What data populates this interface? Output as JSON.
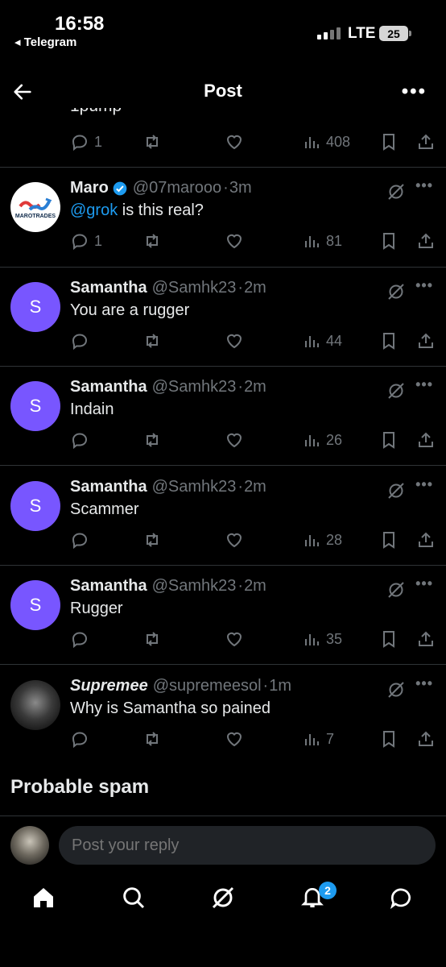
{
  "status_bar": {
    "time": "16:58",
    "back_app": "◂ Telegram",
    "network": "LTE",
    "battery": "25"
  },
  "header": {
    "title": "Post"
  },
  "top_post": {
    "text_fragment": "1pump",
    "replies": "1",
    "views": "408"
  },
  "replies": [
    {
      "name": "Maro",
      "verified": true,
      "handle": "@07marooo",
      "time": "3m",
      "mention": "@grok",
      "text": " is this real?",
      "reply_count": "1",
      "views": "81",
      "avatar": "marotrades-logo",
      "avatar_text": "MAROTRADES"
    },
    {
      "name": "Samantha",
      "handle": "@Samhk23",
      "time": "2m",
      "text": "You are a rugger",
      "reply_count": "",
      "views": "44",
      "avatar_letter": "S"
    },
    {
      "name": "Samantha",
      "handle": "@Samhk23",
      "time": "2m",
      "text": "Indain",
      "reply_count": "",
      "views": "26",
      "avatar_letter": "S"
    },
    {
      "name": "Samantha",
      "handle": "@Samhk23",
      "time": "2m",
      "text": "Scammer",
      "reply_count": "",
      "views": "28",
      "avatar_letter": "S"
    },
    {
      "name": "Samantha",
      "handle": "@Samhk23",
      "time": "2m",
      "text": "Rugger",
      "reply_count": "",
      "views": "35",
      "avatar_letter": "S"
    },
    {
      "name": "Supremee",
      "handle": "@supremeesol",
      "time": "1m",
      "text": "Why is Samantha so pained",
      "reply_count": "",
      "views": "7",
      "avatar": "photo-avatar"
    }
  ],
  "section": {
    "probable_spam": "Probable spam"
  },
  "reply_box": {
    "placeholder": "Post your reply"
  },
  "tabbar": {
    "notifications_badge": "2"
  },
  "colors": {
    "accent": "#1d9bf0",
    "avatar_purple": "#7856ff",
    "muted": "#71767b"
  }
}
